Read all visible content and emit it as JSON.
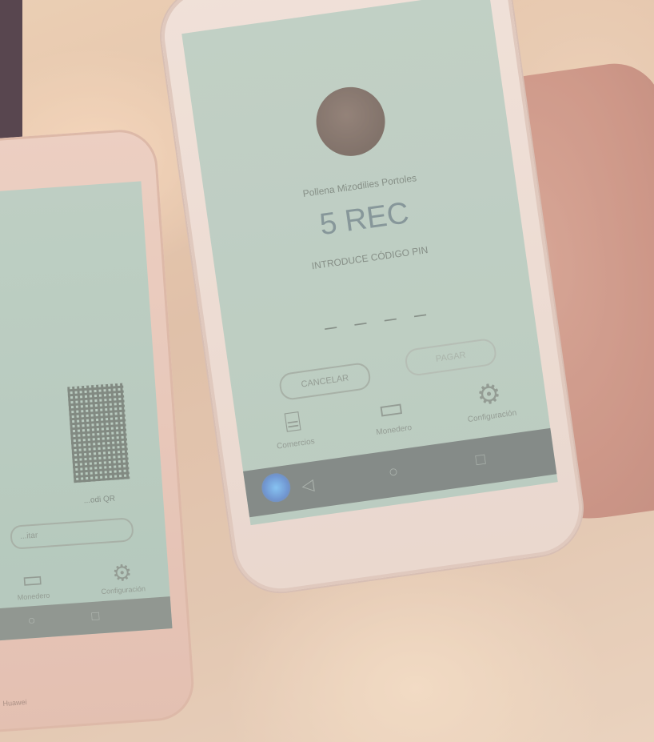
{
  "main_phone": {
    "user_name": "Pollena Mizodilies Portoles",
    "amount": "5 REC",
    "pin_label": "INTRODUCE CÓDIGO PIN",
    "pin_placeholder": "_ _ _ _",
    "cancel_label": "CANCELAR",
    "pay_label": "PAGAR",
    "nav": [
      {
        "label": "Comercios",
        "icon": "store-icon"
      },
      {
        "label": "Monedero",
        "icon": "wallet-icon"
      },
      {
        "label": "Configuración",
        "icon": "gear-icon"
      }
    ],
    "system_nav": {
      "back": "◁",
      "home": "○",
      "recent": "□"
    }
  },
  "left_phone": {
    "qr_caption": "...odi QR",
    "button_label": "...itar",
    "nav": [
      {
        "label": "Monedero",
        "icon": "wallet-icon"
      },
      {
        "label": "Configuración",
        "icon": "gear-icon"
      }
    ],
    "footer_text": "Huawei"
  }
}
